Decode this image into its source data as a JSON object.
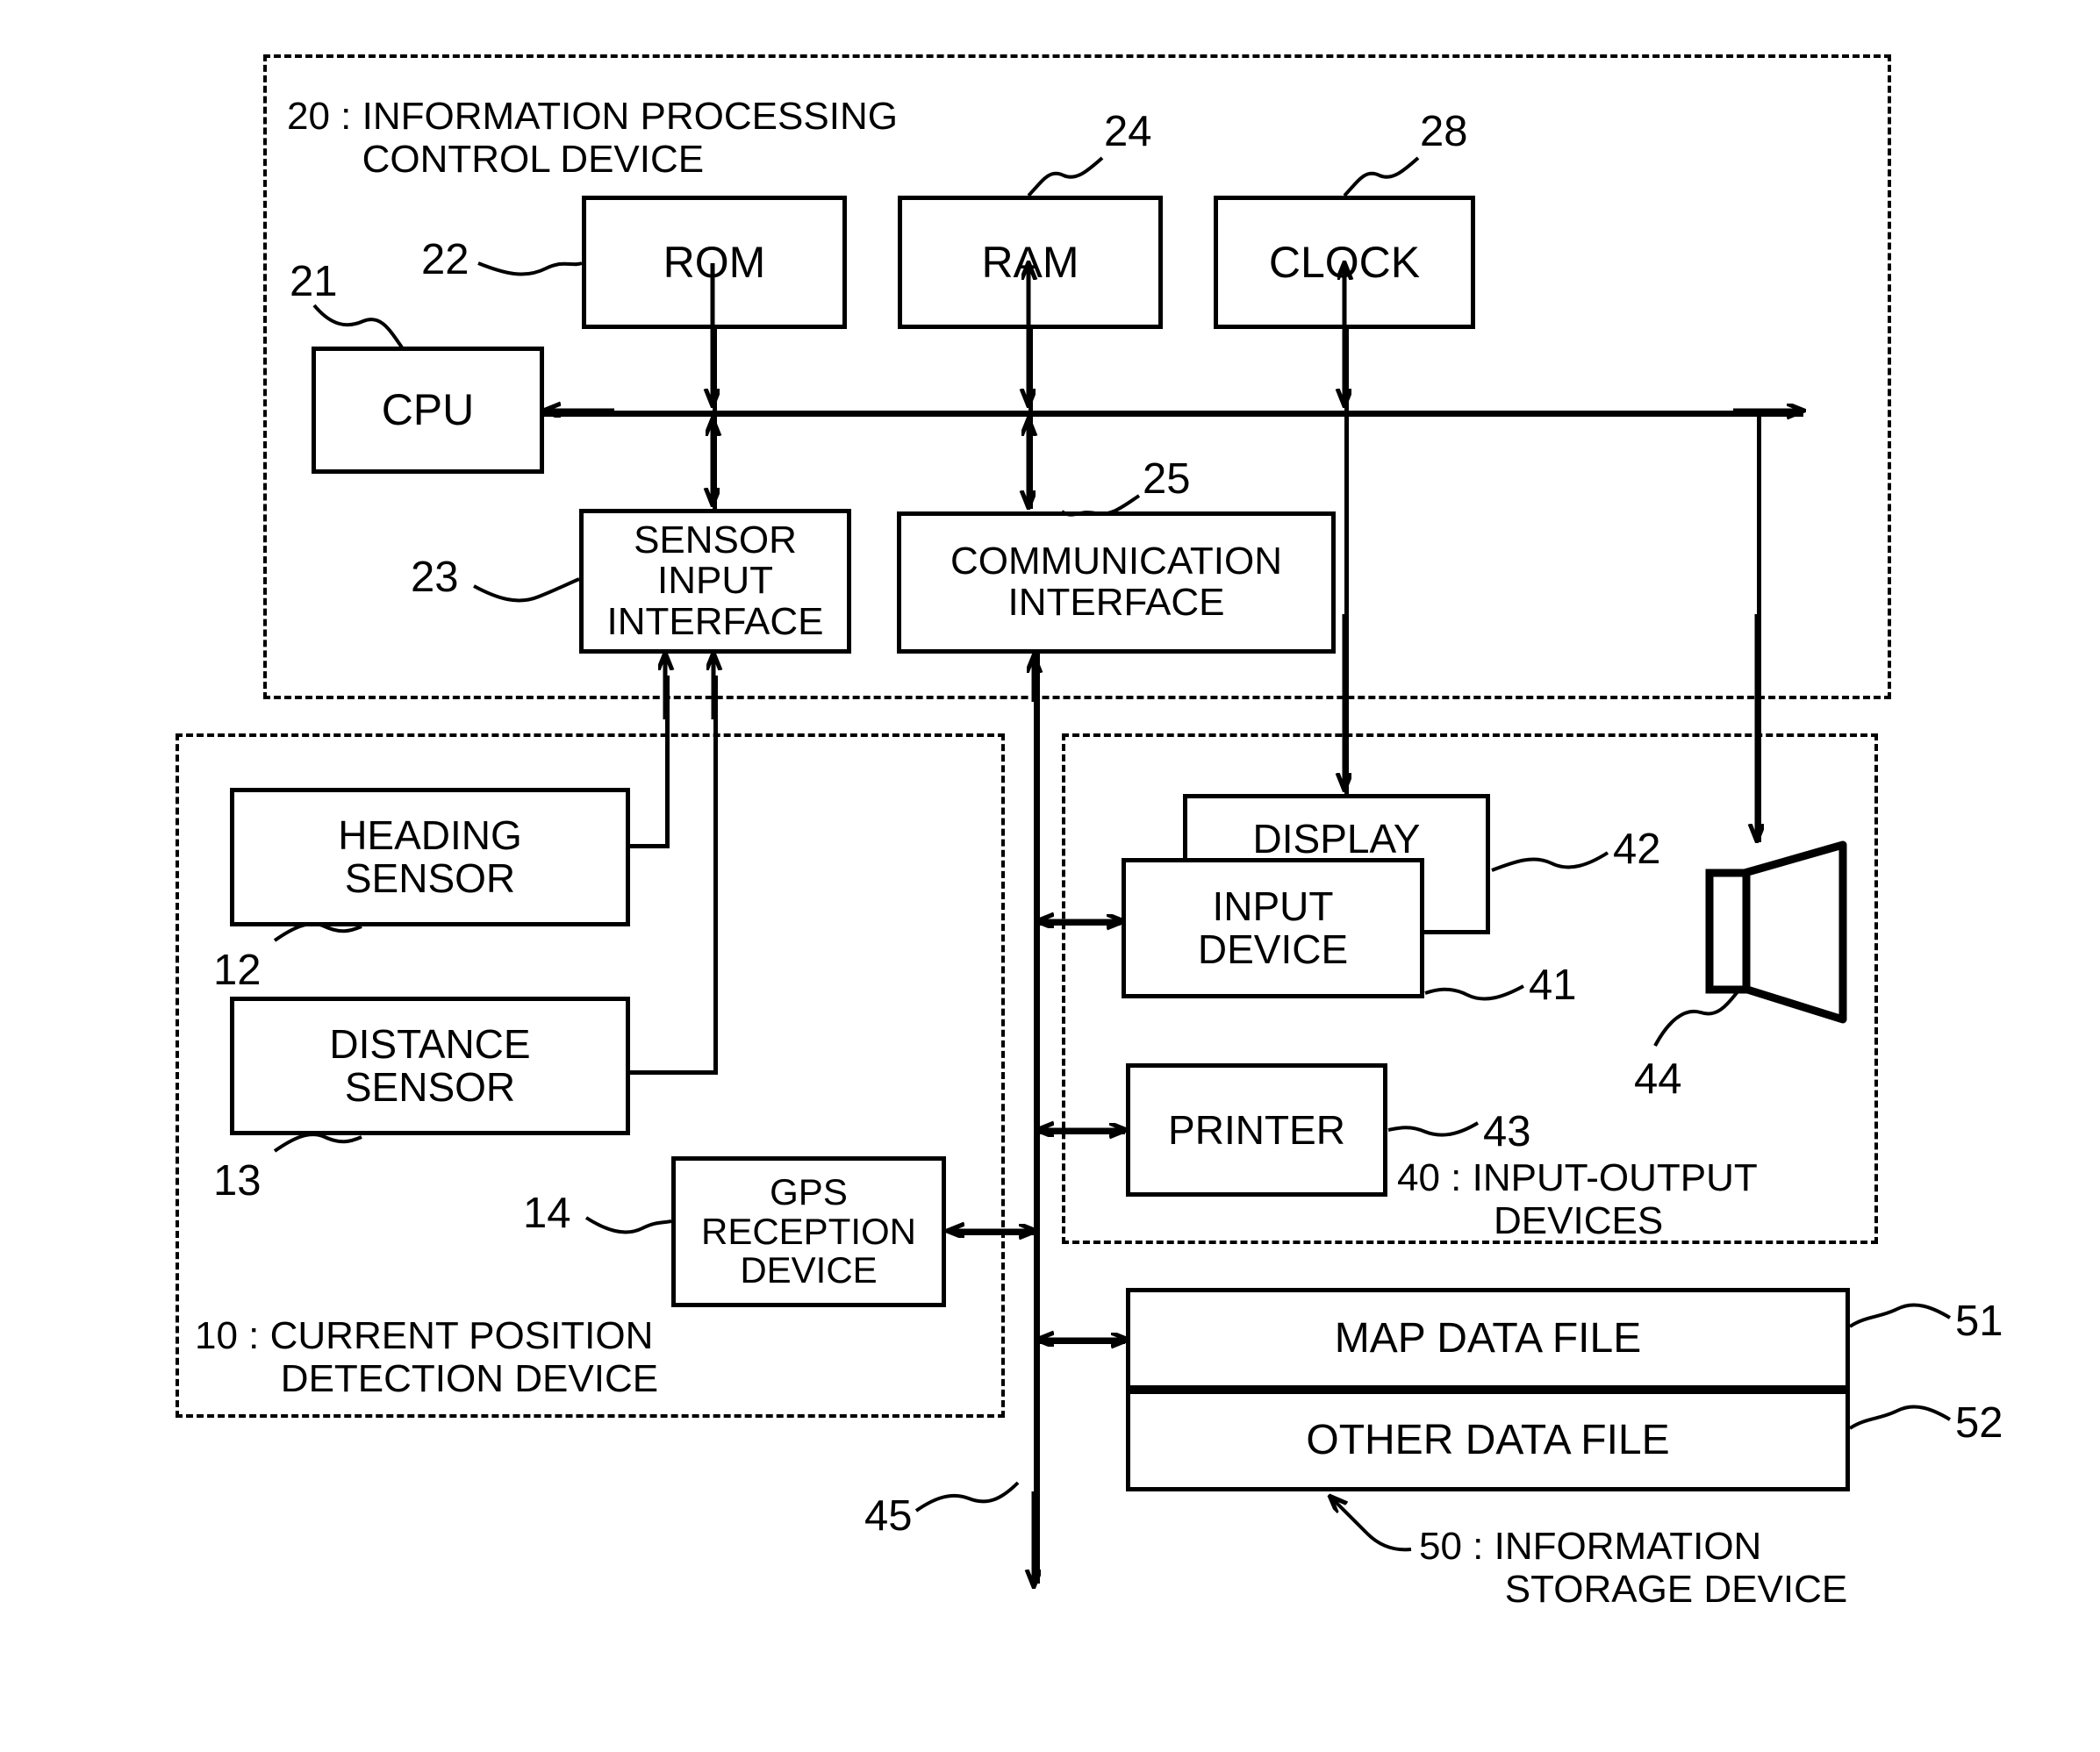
{
  "figure": {
    "type": "patent-block-diagram",
    "groups": [
      {
        "ref": "20",
        "sep": ":",
        "name_line1": "INFORMATION PROCESSING",
        "name_line2": "CONTROL DEVICE"
      },
      {
        "ref": "10",
        "sep": ":",
        "name_line1": "CURRENT POSITION",
        "name_line2": "DETECTION DEVICE"
      },
      {
        "ref": "40",
        "sep": ":",
        "name_line1": "INPUT-OUTPUT",
        "name_line2": "DEVICES"
      },
      {
        "ref": "50",
        "sep": ":",
        "name_line1": "INFORMATION",
        "name_line2": "STORAGE DEVICE"
      }
    ],
    "blocks": [
      {
        "ref": "21",
        "label": "CPU"
      },
      {
        "ref": "22",
        "label": "ROM"
      },
      {
        "ref": "24",
        "label": "RAM"
      },
      {
        "ref": "28",
        "label": "CLOCK"
      },
      {
        "ref": "23",
        "label_line1": "SENSOR",
        "label_line2": "INPUT",
        "label_line3": "INTERFACE"
      },
      {
        "ref": "25",
        "label_line1": "COMMUNICATION",
        "label_line2": "INTERFACE"
      },
      {
        "ref": "12",
        "label_line1": "HEADING",
        "label_line2": "SENSOR"
      },
      {
        "ref": "13",
        "label_line1": "DISTANCE",
        "label_line2": "SENSOR"
      },
      {
        "ref": "14",
        "label_line1": "GPS",
        "label_line2": "RECEPTION",
        "label_line3": "DEVICE"
      },
      {
        "ref": "42",
        "label": "DISPLAY"
      },
      {
        "ref": "41",
        "label_line1": "INPUT",
        "label_line2": "DEVICE"
      },
      {
        "ref": "43",
        "label": "PRINTER"
      },
      {
        "ref": "44",
        "label": "",
        "icon": "speaker-icon"
      },
      {
        "ref": "51",
        "label": "MAP DATA FILE"
      },
      {
        "ref": "52",
        "label": "OTHER DATA FILE"
      },
      {
        "ref": "45",
        "label": "",
        "icon": "bus-line"
      }
    ],
    "text": {
      "cpu": "CPU",
      "rom": "ROM",
      "ram": "RAM",
      "clock": "CLOCK",
      "sensor_if_1": "SENSOR",
      "sensor_if_2": "INPUT",
      "sensor_if_3": "INTERFACE",
      "comm_if_1": "COMMUNICATION",
      "comm_if_2": "INTERFACE",
      "heading_1": "HEADING",
      "heading_2": "SENSOR",
      "distance_1": "DISTANCE",
      "distance_2": "SENSOR",
      "gps_1": "GPS",
      "gps_2": "RECEPTION",
      "gps_3": "DEVICE",
      "display": "DISPLAY",
      "input_dev_1": "INPUT",
      "input_dev_2": "DEVICE",
      "printer": "PRINTER",
      "map_data_file": "MAP DATA FILE",
      "other_data_file": "OTHER DATA FILE"
    },
    "refs": {
      "r10": "10",
      "r12": "12",
      "r13": "13",
      "r14": "14",
      "r20": "20",
      "r21": "21",
      "r22": "22",
      "r23": "23",
      "r24": "24",
      "r25": "25",
      "r28": "28",
      "r40": "40",
      "r41": "41",
      "r42": "42",
      "r43": "43",
      "r44": "44",
      "r45": "45",
      "r50": "50",
      "r51": "51",
      "r52": "52"
    },
    "captions": {
      "c20": "20 : INFORMATION PROCESSING\n       CONTROL DEVICE",
      "c10": "10 : CURRENT POSITION\n        DETECTION DEVICE",
      "c40": "40 : INPUT-OUTPUT\n         DEVICES",
      "c50": "50 : INFORMATION\n        STORAGE DEVICE"
    },
    "colors": {
      "ink": "#000000",
      "paper": "#ffffff"
    }
  }
}
